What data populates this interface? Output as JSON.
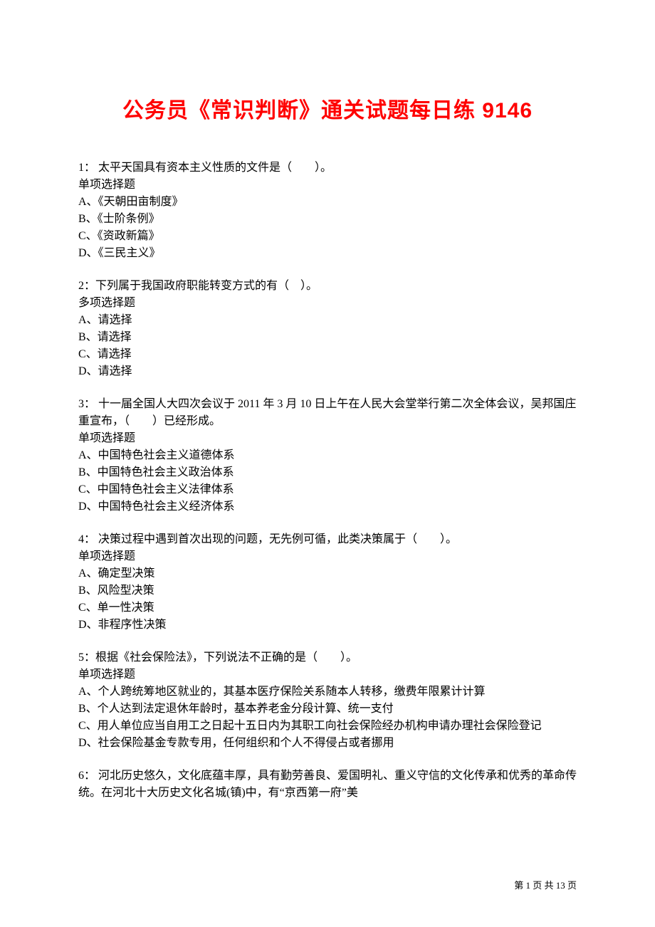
{
  "title": "公务员《常识判断》通关试题每日练 9146",
  "questions": [
    {
      "prompt": "1：  太平天国具有资本主义性质的文件是（　　）。",
      "type": "单项选择题",
      "options": [
        "A、《天朝田亩制度》",
        "B、《士阶条例》",
        "C、《资政新篇》",
        "D、《三民主义》"
      ]
    },
    {
      "prompt": "2：下列属于我国政府职能转变方式的有（　）。",
      "type": "多项选择题",
      "options": [
        "A、请选择",
        "B、请选择",
        "C、请选择",
        "D、请选择"
      ]
    },
    {
      "prompt": "3： 十一届全国人大四次会议于 2011 年 3 月 10 日上午在人民大会堂举行第二次全体会议，吴邦国庄重宣布，（　　）已经形成。",
      "type": "单项选择题",
      "options": [
        "A、中国特色社会主义道德体系",
        "B、中国特色社会主义政治体系",
        "C、中国特色社会主义法律体系",
        "D、中国特色社会主义经济体系"
      ]
    },
    {
      "prompt": "4：  决策过程中遇到首次出现的问题，无先例可循，此类决策属于（　　）。",
      "type": "单项选择题",
      "options": [
        "A、确定型决策",
        "B、风险型决策",
        "C、单一性决策",
        "D、非程序性决策"
      ]
    },
    {
      "prompt": "5：根据《社会保险法》，下列说法不正确的是（　　）。",
      "type": "单项选择题",
      "options": [
        "A、个人跨统筹地区就业的，其基本医疗保险关系随本人转移，缴费年限累计计算",
        "B、个人达到法定退休年龄时，基本养老金分段计算、统一支付",
        "C、用人单位应当自用工之日起十五日内为其职工向社会保险经办机构申请办理社会保险登记",
        "D、社会保险基金专款专用，任何组织和个人不得侵占或者挪用"
      ]
    },
    {
      "prompt": "6： 河北历史悠久，文化底蕴丰厚，具有勤劳善良、爱国明礼、重义守信的文化传承和优秀的革命传统。在河北十大历史文化名城(镇)中，有“京西第一府”美",
      "type": "",
      "options": []
    }
  ],
  "footer": {
    "prefix": "第 ",
    "current": "1",
    "middle": " 页 共 ",
    "total": "13",
    "suffix": " 页"
  }
}
